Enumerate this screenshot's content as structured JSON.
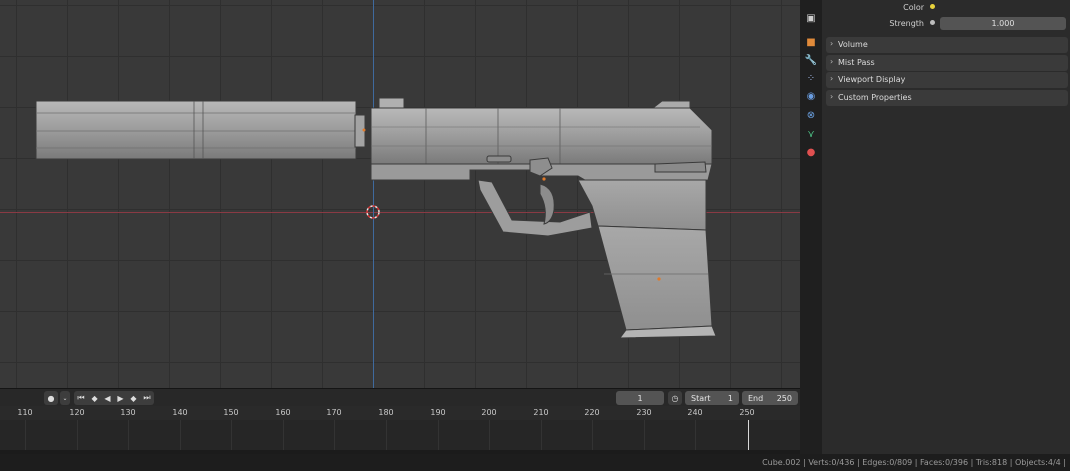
{
  "properties": {
    "color_label": "Color",
    "strength_label": "Strength",
    "strength_value": "1.000",
    "color_dot": "#e8d33c",
    "panels": [
      "Volume",
      "Mist Pass",
      "Viewport Display",
      "Custom Properties"
    ]
  },
  "tabs": {
    "icons": [
      "render-icon",
      "object-icon",
      "modifier-icon",
      "particles-icon",
      "physics-icon",
      "constraints-icon",
      "data-icon",
      "material-icon"
    ]
  },
  "timeline": {
    "current_frame": "1",
    "start_label": "Start",
    "start_value": "1",
    "end_label": "End",
    "end_value": "250",
    "ticks": [
      "110",
      "120",
      "130",
      "140",
      "150",
      "160",
      "170",
      "180",
      "190",
      "200",
      "210",
      "220",
      "230",
      "240",
      "250"
    ]
  },
  "status": {
    "text": "Cube.002 | Verts:0/436 | Edges:0/809 | Faces:0/396 | Tris:818 | Objects:4/4 |"
  },
  "colors": {
    "x_axis": "#8a3a44",
    "z_axis": "#3f6a9e",
    "grid": "#393939"
  }
}
